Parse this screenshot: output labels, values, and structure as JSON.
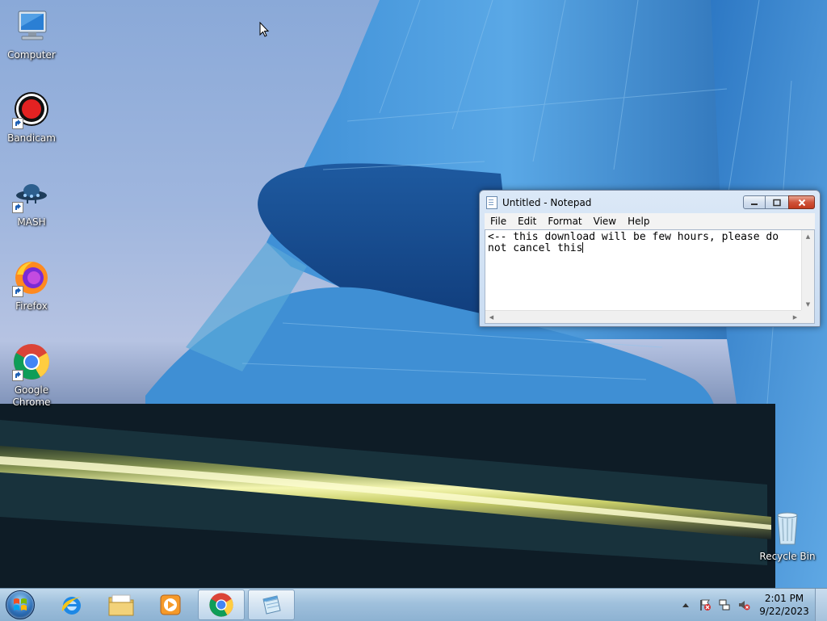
{
  "desktop": {
    "icons": [
      {
        "label": "Computer",
        "icon": "computer-icon"
      },
      {
        "label": "Bandicam",
        "icon": "bandicam-icon"
      },
      {
        "label": "MASH",
        "icon": "mash-icon"
      },
      {
        "label": "Firefox",
        "icon": "firefox-icon"
      },
      {
        "label": "Google Chrome",
        "icon": "chrome-icon"
      },
      {
        "label": "Recycle Bin",
        "icon": "recycle-bin-icon"
      }
    ]
  },
  "notepad": {
    "title": "Untitled - Notepad",
    "menu": [
      "File",
      "Edit",
      "Format",
      "View",
      "Help"
    ],
    "text": "<-- this download will be few hours, please do not cancel this",
    "buttons": {
      "minimize": "minimize-icon",
      "maximize": "maximize-icon",
      "close": "close-icon"
    }
  },
  "taskbar": {
    "pinned": [
      "start-orb-icon",
      "internet-explorer-icon",
      "file-explorer-icon",
      "media-player-icon",
      "chrome-icon",
      "notepad-icon"
    ],
    "active_items": [
      "chrome",
      "notepad"
    ],
    "tray_icons": [
      "show-hidden-icons-icon",
      "action-center-flag-icon",
      "network-icon",
      "volume-muted-icon"
    ],
    "clock": {
      "time": "2:01 PM",
      "date": "9/22/2023"
    }
  },
  "colors": {
    "taskbar": "#9fc0dc",
    "close_button": "#c23a1f",
    "wallpaper_blue": "#2f7fc8",
    "wallpaper_yellow": "#f0f0a0"
  }
}
